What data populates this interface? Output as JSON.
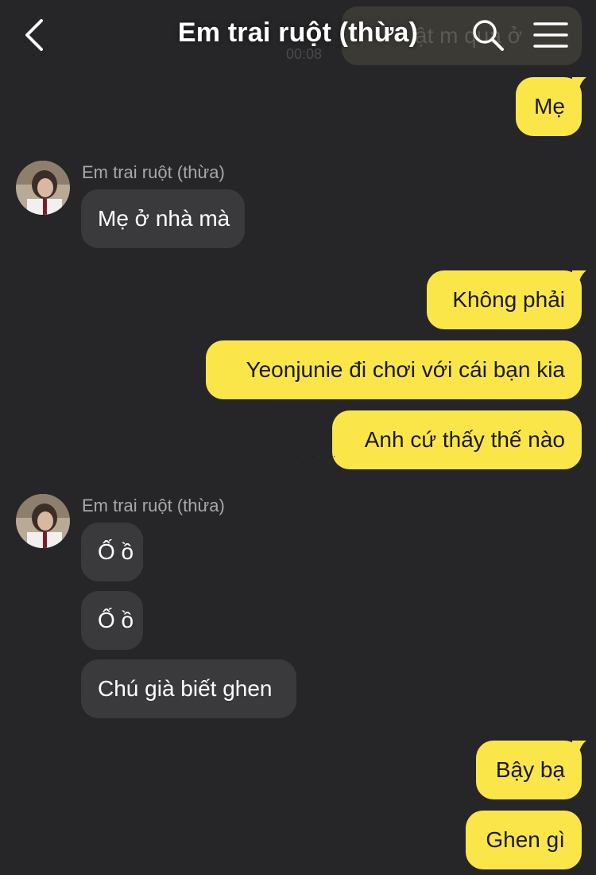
{
  "header": {
    "title": "Em trai ruột (thừa)"
  },
  "faded_message": {
    "text": "ật m qua ở",
    "time": "00:08"
  },
  "messages": [
    {
      "side": "me",
      "text": "Mẹ"
    },
    {
      "side": "them",
      "sender": "Em trai ruột (thừa)",
      "text": "Mẹ ở nhà mà"
    },
    {
      "side": "me",
      "text": "Không phải"
    },
    {
      "side": "me",
      "text": "Yeonjunie đi chơi với cái bạn kia"
    },
    {
      "side": "me",
      "text": "Anh cứ thấy thế nào"
    },
    {
      "side": "them",
      "sender": "Em trai ruột (thừa)",
      "text": "Ố ồ"
    },
    {
      "side": "them",
      "text": "Ố ồ"
    },
    {
      "side": "them",
      "text": "Chú già biết ghen"
    },
    {
      "side": "me",
      "text": "Bậy bạ"
    },
    {
      "side": "me",
      "text": "Ghen gì"
    }
  ],
  "colors": {
    "background": "#262628",
    "my_bubble": "#fbe64a",
    "their_bubble": "#3a3a3c",
    "header_text": "#ffffff"
  },
  "icons": [
    "back-arrow-icon",
    "search-icon",
    "menu-icon"
  ]
}
